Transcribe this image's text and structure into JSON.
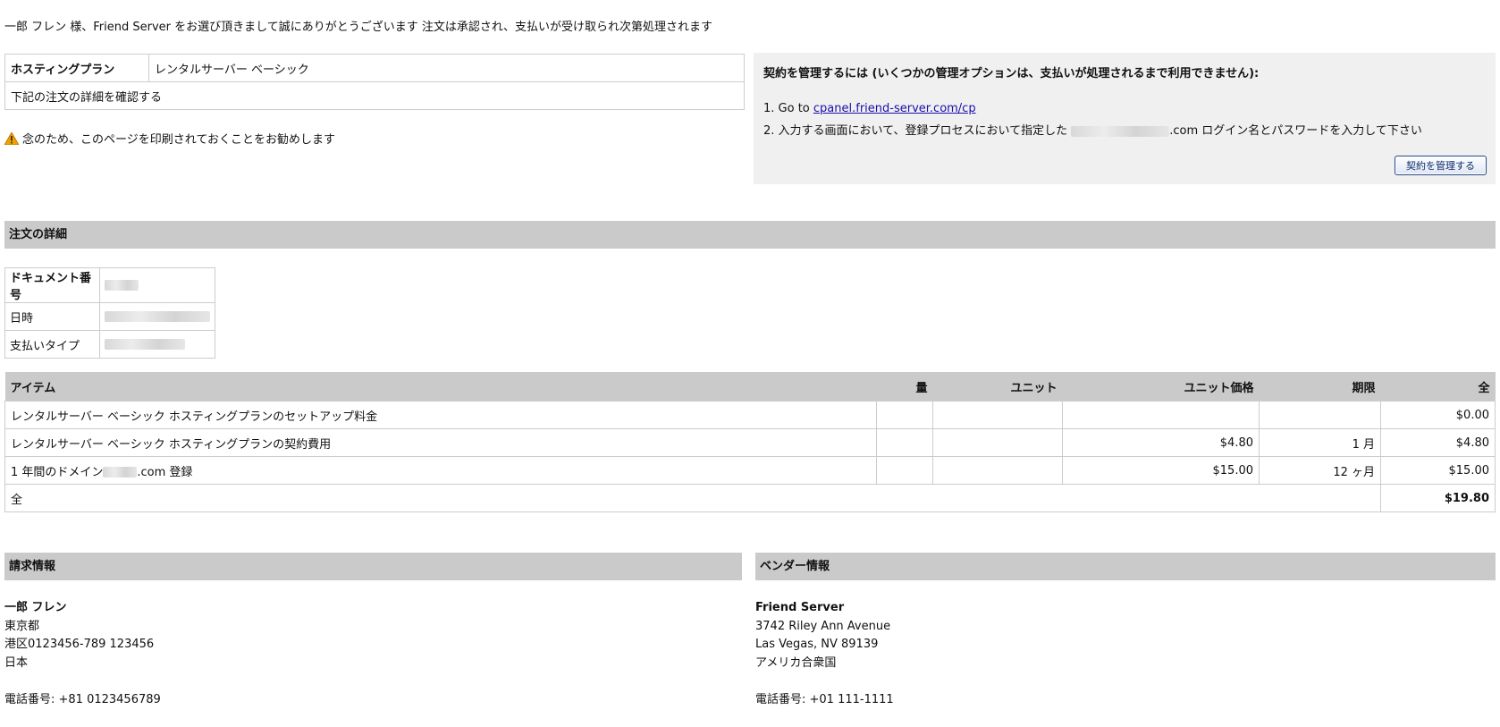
{
  "intro": "一郎 フレン 様、Friend Server をお選び頂きまして誠にありがとうございます 注文は承認され、支払いが受け取られ次第処理されます",
  "plan": {
    "label": "ホスティングプラン",
    "value": "レンタルサーバー ベーシック",
    "confirm": "下記の注文の詳細を確認する"
  },
  "notice": {
    "icon": "warning-icon",
    "text": "念のため、このページを印刷されておくことをお勧めします"
  },
  "manage": {
    "title": "契約を管理するには (いくつかの管理オプションは、支払いが処理されるまで利用できません):",
    "step1_prefix": "1. Go to ",
    "step1_link": "cpanel.friend-server.com/cp",
    "step2_prefix": "2. 入力する画面において、登録プロセスにおいて指定した",
    "step2_suffix": ".com ログイン名とパスワードを入力して下さい",
    "button": "契約を管理する"
  },
  "order_details": {
    "title": "注文の詳細",
    "doc_number_label": "ドキュメント番号",
    "date_label": "日時",
    "payment_type_label": "支払いタイプ"
  },
  "items": {
    "headers": {
      "item": "アイテム",
      "qty": "量",
      "unit": "ユニット",
      "unit_price": "ユニット価格",
      "term": "期限",
      "total": "全"
    },
    "rows": [
      {
        "item": "レンタルサーバー ベーシック ホスティングプランのセットアップ料金",
        "qty": "",
        "unit": "",
        "unit_price": "",
        "term": "",
        "total": "$0.00"
      },
      {
        "item": "レンタルサーバー ベーシック ホスティングプランの契約費用",
        "qty": "",
        "unit": "",
        "unit_price": "$4.80",
        "term": "1 月",
        "total": "$4.80"
      },
      {
        "item_prefix": "1 年間のドメイン",
        "item_suffix": ".com 登録",
        "qty": "",
        "unit": "",
        "unit_price": "$15.00",
        "term": "12 ヶ月",
        "total": "$15.00"
      }
    ],
    "total_label": "全",
    "total_value": "$19.80"
  },
  "billing": {
    "title": "請求情報",
    "name": "一郎 フレン",
    "line1": "東京都",
    "line2": "港区0123456-789 123456",
    "line3": "日本",
    "phone": "電話番号: +81 0123456789"
  },
  "vendor": {
    "title": "ベンダー情報",
    "name": "Friend Server",
    "line1": "3742 Riley Ann Avenue",
    "line2": "Las Vegas, NV 89139",
    "line3": "アメリカ合衆国",
    "phone": "電話番号: +01 111-1111"
  },
  "colors": {
    "section_bg": "#cacaca",
    "panel_bg": "#f0f0f0",
    "link": "#1a0dab",
    "warning": "#f0a000"
  }
}
